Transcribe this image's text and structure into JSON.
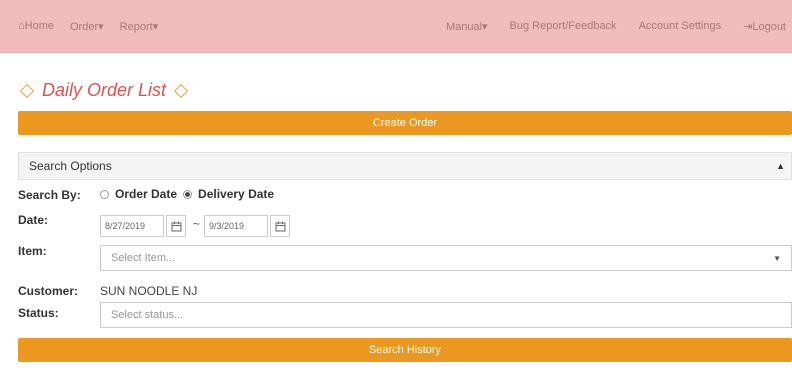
{
  "nav": {
    "left": [
      "⌂Home",
      "Order▾",
      "Report▾"
    ],
    "right": [
      "Manual▾",
      "Bug Report/Feedback",
      "Account Settings",
      "⇥Logout"
    ]
  },
  "page_title": "Daily Order List",
  "create_order_label": "Create Order",
  "search_options_label": "Search Options",
  "search_by": {
    "label": "Search By:",
    "options": [
      "Order Date",
      "Delivery Date"
    ],
    "selected": "Delivery Date"
  },
  "date": {
    "label": "Date:",
    "from": "8/27/2019",
    "to": "9/3/2019",
    "separator": "~"
  },
  "item": {
    "label": "Item:",
    "placeholder": "Select Item..."
  },
  "customer": {
    "label": "Customer:",
    "value": "SUN NOODLE NJ"
  },
  "status": {
    "label": "Status:",
    "placeholder": "Select status..."
  },
  "search_button_label": "Search History"
}
